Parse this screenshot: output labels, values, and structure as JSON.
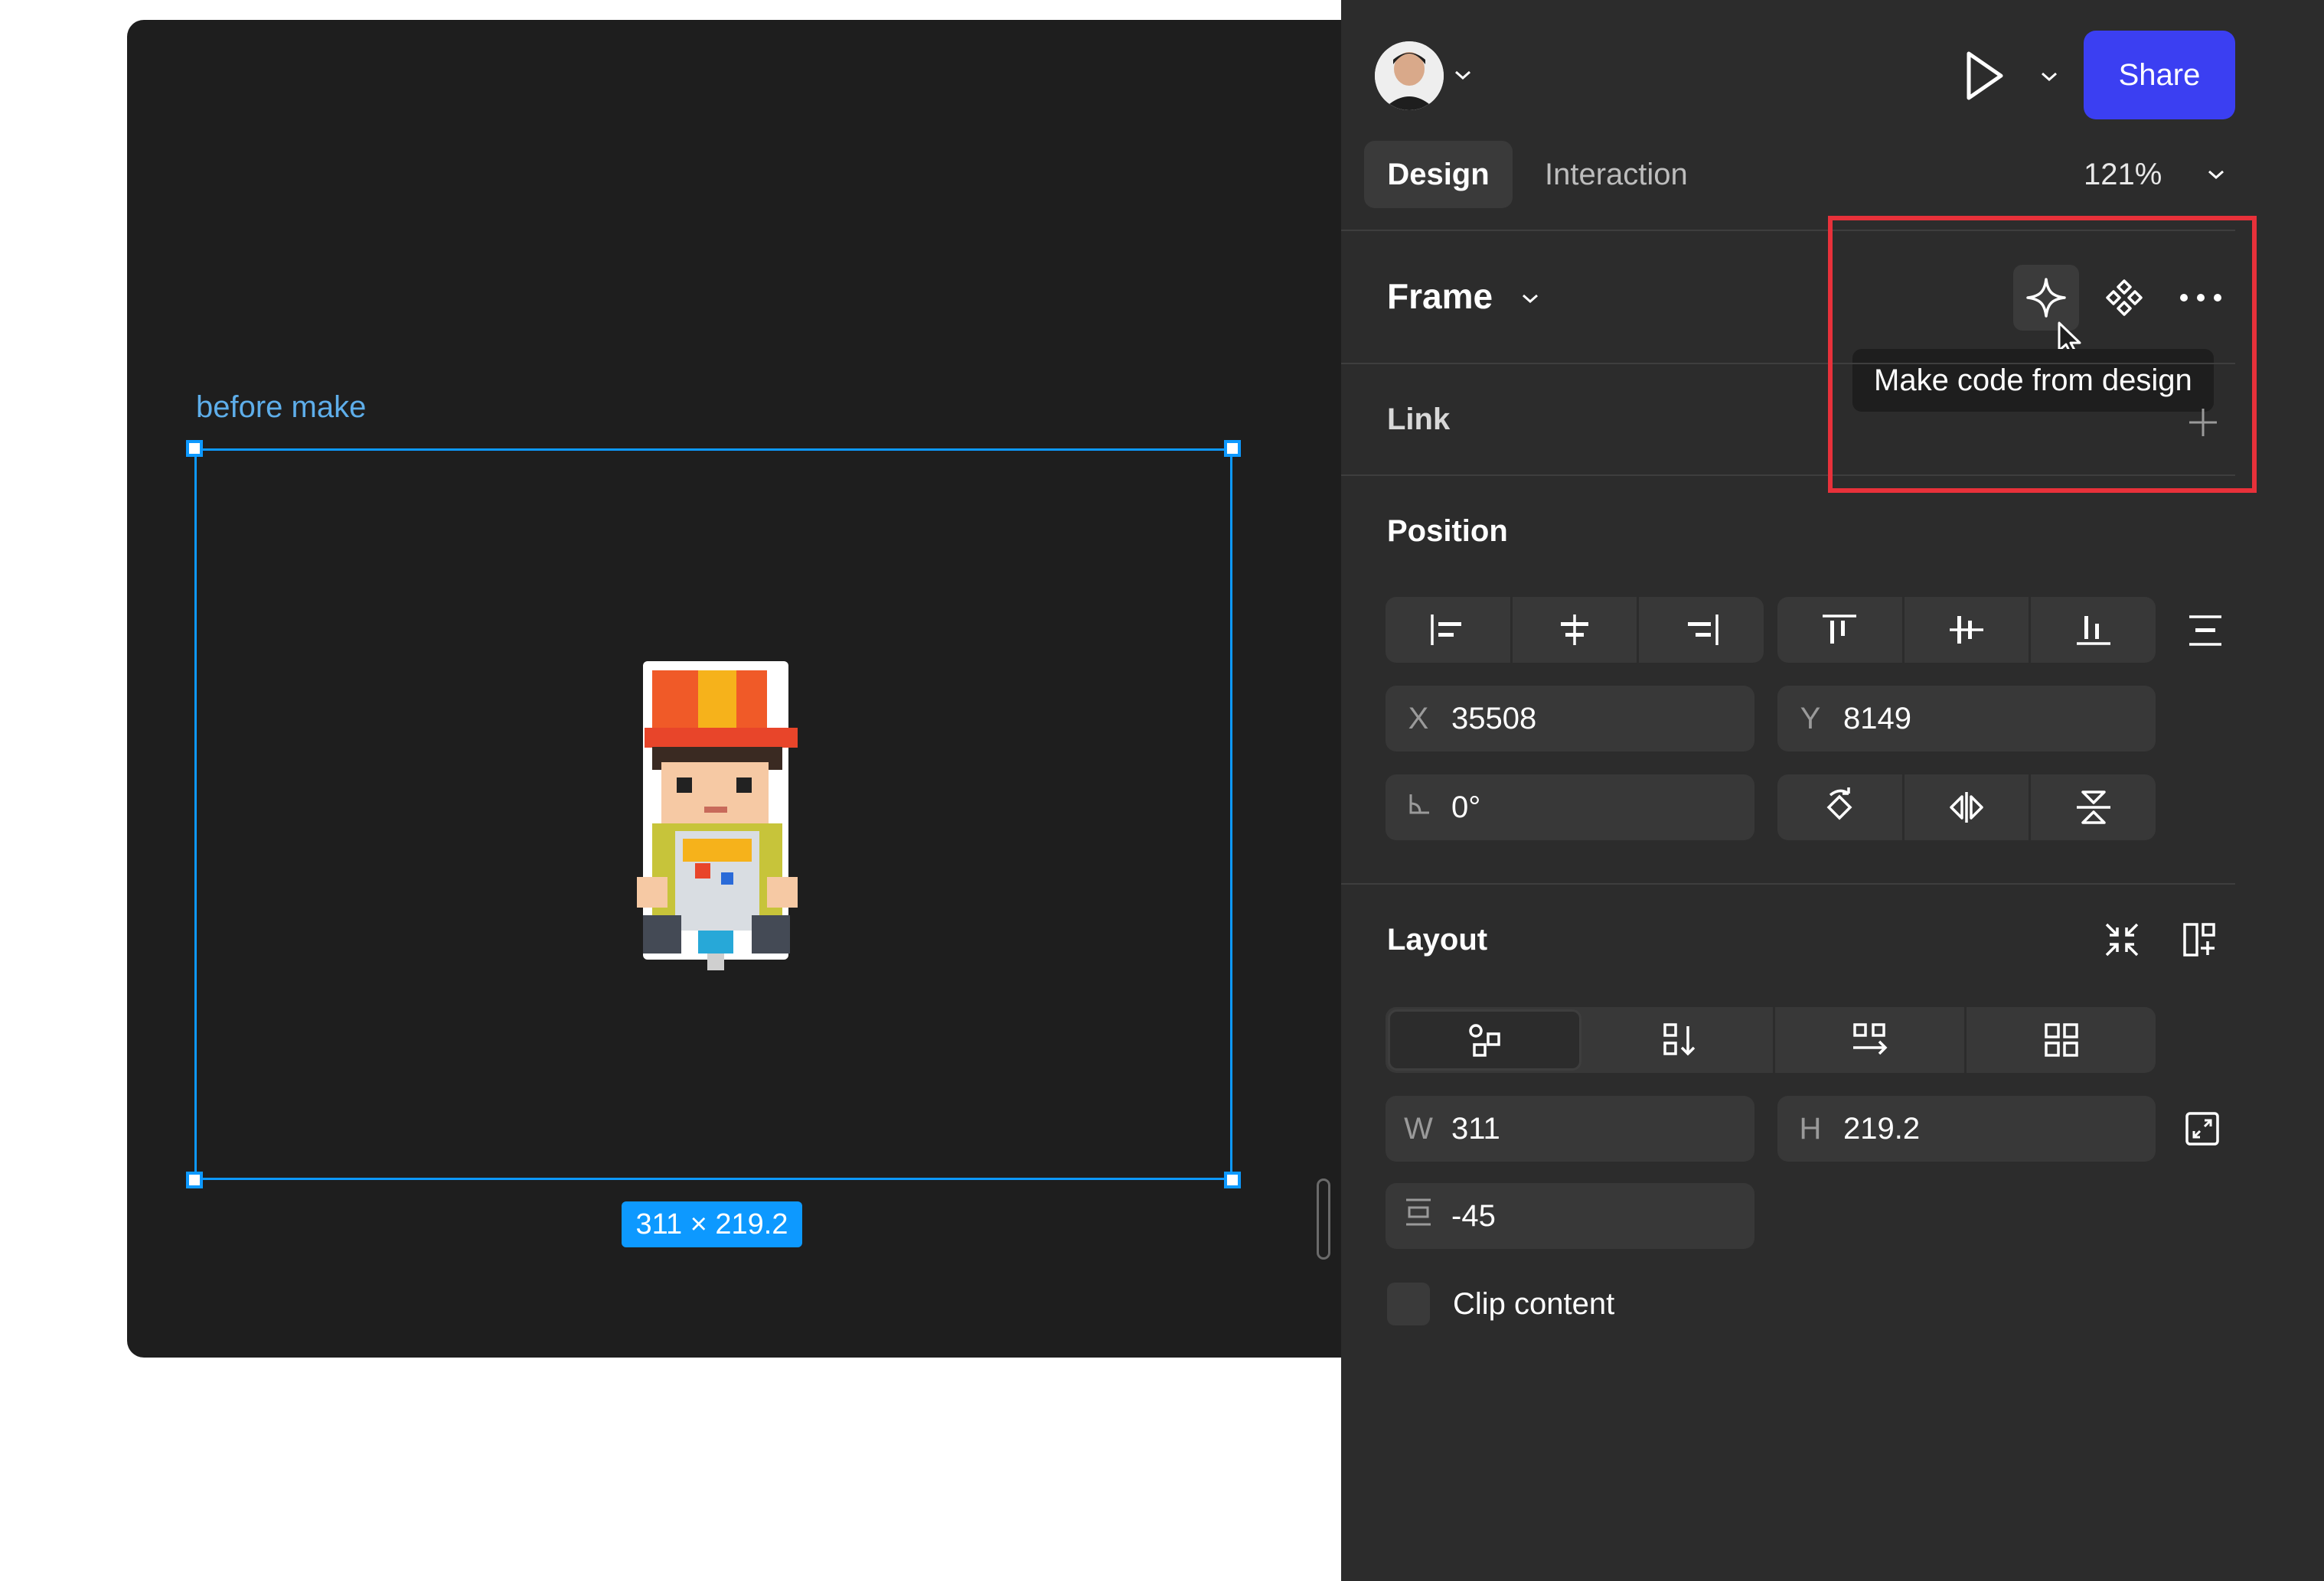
{
  "canvas": {
    "frame_label": "before make",
    "selection_size": "311 × 219.2"
  },
  "toolbar": {
    "share_label": "Share"
  },
  "tabs": {
    "design": "Design",
    "interaction": "Interaction"
  },
  "zoom": "121%",
  "frame": {
    "title": "Frame",
    "tooltip": "Make code from design"
  },
  "link": {
    "label": "Link"
  },
  "position": {
    "label": "Position",
    "x_label": "X",
    "x_value": "35508",
    "y_label": "Y",
    "y_value": "8149",
    "rotation_value": "0°"
  },
  "layout": {
    "label": "Layout",
    "w_label": "W",
    "w_value": "311",
    "h_label": "H",
    "h_value": "219.2",
    "gap_value": "-45",
    "clip_label": "Clip content"
  },
  "colors": {
    "accent": "#0d99ff",
    "share": "#3b3ff2",
    "highlight": "#e8313a",
    "panel_bg": "#2c2c2c",
    "canvas_bg": "#1e1e1e"
  }
}
